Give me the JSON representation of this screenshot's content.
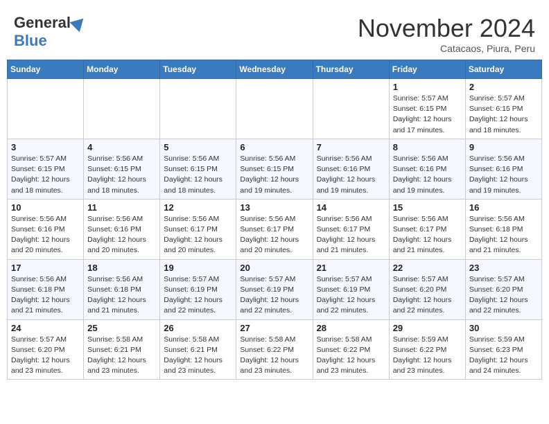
{
  "header": {
    "logo_general": "General",
    "logo_blue": "Blue",
    "month_title": "November 2024",
    "location": "Catacaos, Piura, Peru"
  },
  "days_of_week": [
    "Sunday",
    "Monday",
    "Tuesday",
    "Wednesday",
    "Thursday",
    "Friday",
    "Saturday"
  ],
  "weeks": [
    [
      {
        "day": "",
        "info": ""
      },
      {
        "day": "",
        "info": ""
      },
      {
        "day": "",
        "info": ""
      },
      {
        "day": "",
        "info": ""
      },
      {
        "day": "",
        "info": ""
      },
      {
        "day": "1",
        "info": "Sunrise: 5:57 AM\nSunset: 6:15 PM\nDaylight: 12 hours\nand 17 minutes."
      },
      {
        "day": "2",
        "info": "Sunrise: 5:57 AM\nSunset: 6:15 PM\nDaylight: 12 hours\nand 18 minutes."
      }
    ],
    [
      {
        "day": "3",
        "info": "Sunrise: 5:57 AM\nSunset: 6:15 PM\nDaylight: 12 hours\nand 18 minutes."
      },
      {
        "day": "4",
        "info": "Sunrise: 5:56 AM\nSunset: 6:15 PM\nDaylight: 12 hours\nand 18 minutes."
      },
      {
        "day": "5",
        "info": "Sunrise: 5:56 AM\nSunset: 6:15 PM\nDaylight: 12 hours\nand 18 minutes."
      },
      {
        "day": "6",
        "info": "Sunrise: 5:56 AM\nSunset: 6:15 PM\nDaylight: 12 hours\nand 19 minutes."
      },
      {
        "day": "7",
        "info": "Sunrise: 5:56 AM\nSunset: 6:16 PM\nDaylight: 12 hours\nand 19 minutes."
      },
      {
        "day": "8",
        "info": "Sunrise: 5:56 AM\nSunset: 6:16 PM\nDaylight: 12 hours\nand 19 minutes."
      },
      {
        "day": "9",
        "info": "Sunrise: 5:56 AM\nSunset: 6:16 PM\nDaylight: 12 hours\nand 19 minutes."
      }
    ],
    [
      {
        "day": "10",
        "info": "Sunrise: 5:56 AM\nSunset: 6:16 PM\nDaylight: 12 hours\nand 20 minutes."
      },
      {
        "day": "11",
        "info": "Sunrise: 5:56 AM\nSunset: 6:16 PM\nDaylight: 12 hours\nand 20 minutes."
      },
      {
        "day": "12",
        "info": "Sunrise: 5:56 AM\nSunset: 6:17 PM\nDaylight: 12 hours\nand 20 minutes."
      },
      {
        "day": "13",
        "info": "Sunrise: 5:56 AM\nSunset: 6:17 PM\nDaylight: 12 hours\nand 20 minutes."
      },
      {
        "day": "14",
        "info": "Sunrise: 5:56 AM\nSunset: 6:17 PM\nDaylight: 12 hours\nand 21 minutes."
      },
      {
        "day": "15",
        "info": "Sunrise: 5:56 AM\nSunset: 6:17 PM\nDaylight: 12 hours\nand 21 minutes."
      },
      {
        "day": "16",
        "info": "Sunrise: 5:56 AM\nSunset: 6:18 PM\nDaylight: 12 hours\nand 21 minutes."
      }
    ],
    [
      {
        "day": "17",
        "info": "Sunrise: 5:56 AM\nSunset: 6:18 PM\nDaylight: 12 hours\nand 21 minutes."
      },
      {
        "day": "18",
        "info": "Sunrise: 5:56 AM\nSunset: 6:18 PM\nDaylight: 12 hours\nand 21 minutes."
      },
      {
        "day": "19",
        "info": "Sunrise: 5:57 AM\nSunset: 6:19 PM\nDaylight: 12 hours\nand 22 minutes."
      },
      {
        "day": "20",
        "info": "Sunrise: 5:57 AM\nSunset: 6:19 PM\nDaylight: 12 hours\nand 22 minutes."
      },
      {
        "day": "21",
        "info": "Sunrise: 5:57 AM\nSunset: 6:19 PM\nDaylight: 12 hours\nand 22 minutes."
      },
      {
        "day": "22",
        "info": "Sunrise: 5:57 AM\nSunset: 6:20 PM\nDaylight: 12 hours\nand 22 minutes."
      },
      {
        "day": "23",
        "info": "Sunrise: 5:57 AM\nSunset: 6:20 PM\nDaylight: 12 hours\nand 22 minutes."
      }
    ],
    [
      {
        "day": "24",
        "info": "Sunrise: 5:57 AM\nSunset: 6:20 PM\nDaylight: 12 hours\nand 23 minutes."
      },
      {
        "day": "25",
        "info": "Sunrise: 5:58 AM\nSunset: 6:21 PM\nDaylight: 12 hours\nand 23 minutes."
      },
      {
        "day": "26",
        "info": "Sunrise: 5:58 AM\nSunset: 6:21 PM\nDaylight: 12 hours\nand 23 minutes."
      },
      {
        "day": "27",
        "info": "Sunrise: 5:58 AM\nSunset: 6:22 PM\nDaylight: 12 hours\nand 23 minutes."
      },
      {
        "day": "28",
        "info": "Sunrise: 5:58 AM\nSunset: 6:22 PM\nDaylight: 12 hours\nand 23 minutes."
      },
      {
        "day": "29",
        "info": "Sunrise: 5:59 AM\nSunset: 6:22 PM\nDaylight: 12 hours\nand 23 minutes."
      },
      {
        "day": "30",
        "info": "Sunrise: 5:59 AM\nSunset: 6:23 PM\nDaylight: 12 hours\nand 24 minutes."
      }
    ]
  ]
}
